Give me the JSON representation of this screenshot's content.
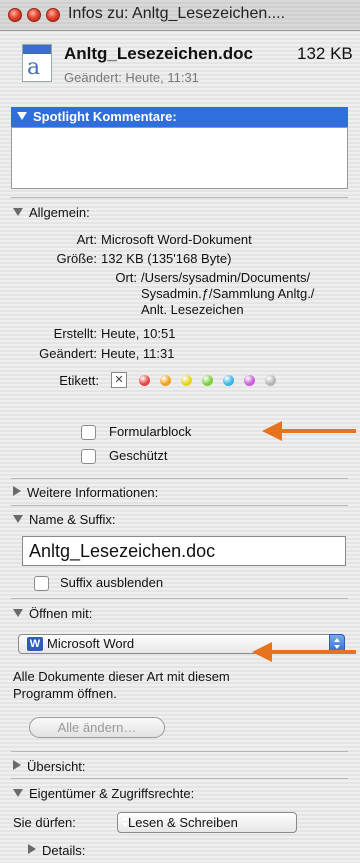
{
  "window": {
    "title": "Infos zu: Anltg_Lesezeichen...."
  },
  "header": {
    "filename": "Anltg_Lesezeichen.doc",
    "size": "132 KB",
    "modified": "Geändert: Heute, 11:31"
  },
  "spotlight": {
    "heading": "Spotlight Kommentare:",
    "comment": ""
  },
  "general": {
    "heading": "Allgemein:",
    "kind_label": "Art:",
    "kind_value": "Microsoft Word-Dokument",
    "size_label": "Größe:",
    "size_value": "132 KB (135'168 Byte)",
    "where_label": "Ort:",
    "where_line1": "/Users/sysadmin/Documents/",
    "where_line2": "Sysadmin.ƒ/Sammlung Anltg./",
    "where_line3": "Anlt. Lesezeichen",
    "created_label": "Erstellt:",
    "created_value": "Heute, 10:51",
    "modified_label": "Geändert:",
    "modified_value": "Heute, 11:31",
    "color_label_label": "Etikett:",
    "label_colors": [
      "#e84545",
      "#f0a21e",
      "#e6d41e",
      "#7bd03b",
      "#3ab5e6",
      "#c95fd9",
      "#b5b5b5"
    ],
    "stationery_label": "Formularblock",
    "locked_label": "Geschützt"
  },
  "more_info": {
    "heading": "Weitere Informationen:"
  },
  "name_ext": {
    "heading": "Name & Suffix:",
    "name_value": "Anltg_Lesezeichen.doc",
    "hide_ext_label": "Suffix ausblenden"
  },
  "open_with": {
    "heading": "Öffnen mit:",
    "app": "Microsoft Word",
    "app_icon": "W",
    "note_line1": "Alle Dokumente dieser Art mit diesem",
    "note_line2": "Programm öffnen.",
    "change_all_button": "Alle ändern…"
  },
  "preview": {
    "heading": "Übersicht:"
  },
  "ownership": {
    "heading": "Eigentümer & Zugriffsrechte:",
    "you_can_label": "Sie dürfen:",
    "permission": "Lesen & Schreiben",
    "details_heading": "Details:"
  },
  "annotation_color": "#e8731f"
}
